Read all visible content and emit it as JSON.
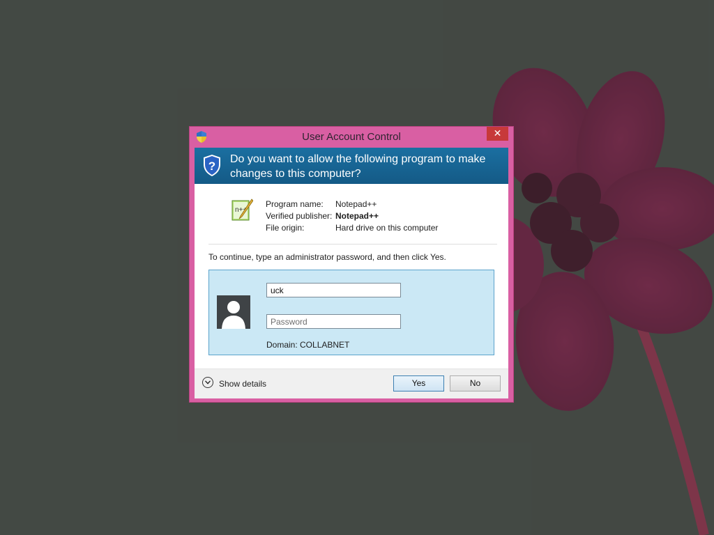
{
  "window": {
    "title": "User Account Control",
    "close_label": "✕",
    "frame_color": "#d95fa3"
  },
  "question": {
    "text": "Do you want to allow the following program to make changes to this computer?",
    "band_color": "#1b6fa1"
  },
  "program_info": {
    "name_label": "Program name:",
    "name_value": "Notepad++",
    "publisher_label": "Verified publisher:",
    "publisher_value": "Notepad++",
    "origin_label": "File origin:",
    "origin_value": "Hard drive on this computer"
  },
  "instruction": "To continue, type an administrator password, and then click Yes.",
  "credentials": {
    "username_value": "uck",
    "password_placeholder": "Password",
    "domain_text": "Domain: COLLABNET",
    "panel_color": "#cbe8f5"
  },
  "footer": {
    "show_details_label": "Show details",
    "yes_label": "Yes",
    "no_label": "No"
  },
  "icons": {
    "title": "uac-shield-icon",
    "question": "uac-shield-icon",
    "program": "notepad-plus-plus-icon",
    "user": "user-avatar-icon",
    "details": "chevron-down-icon"
  }
}
